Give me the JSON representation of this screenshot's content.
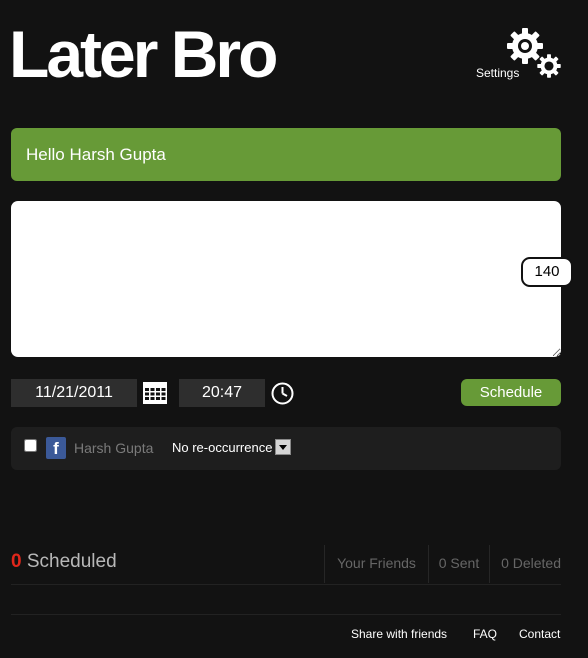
{
  "app": {
    "logo_text": "Later Bro"
  },
  "header": {
    "settings_label": "Settings"
  },
  "greeting": {
    "text": "Hello Harsh Gupta"
  },
  "composer": {
    "message_value": "",
    "char_count": "140"
  },
  "schedule": {
    "date_value": "11/21/2011",
    "time_value": "20:47",
    "button_label": "Schedule"
  },
  "account": {
    "network_icon": "facebook-icon",
    "name": "Harsh Gupta",
    "checked": false,
    "recurrence_selected": "No re-occurrence"
  },
  "stats": {
    "scheduled_count": "0",
    "scheduled_label": "Scheduled",
    "friends_label": "Your Friends",
    "sent_label": "0 Sent",
    "deleted_label": "0 Deleted"
  },
  "footer": {
    "share_label": "Share with friends",
    "faq_label": "FAQ",
    "contact_label": "Contact"
  },
  "colors": {
    "background": "#121212",
    "accent_green": "#679a37",
    "count_red": "#e0271b",
    "facebook_blue": "#3b5998"
  }
}
